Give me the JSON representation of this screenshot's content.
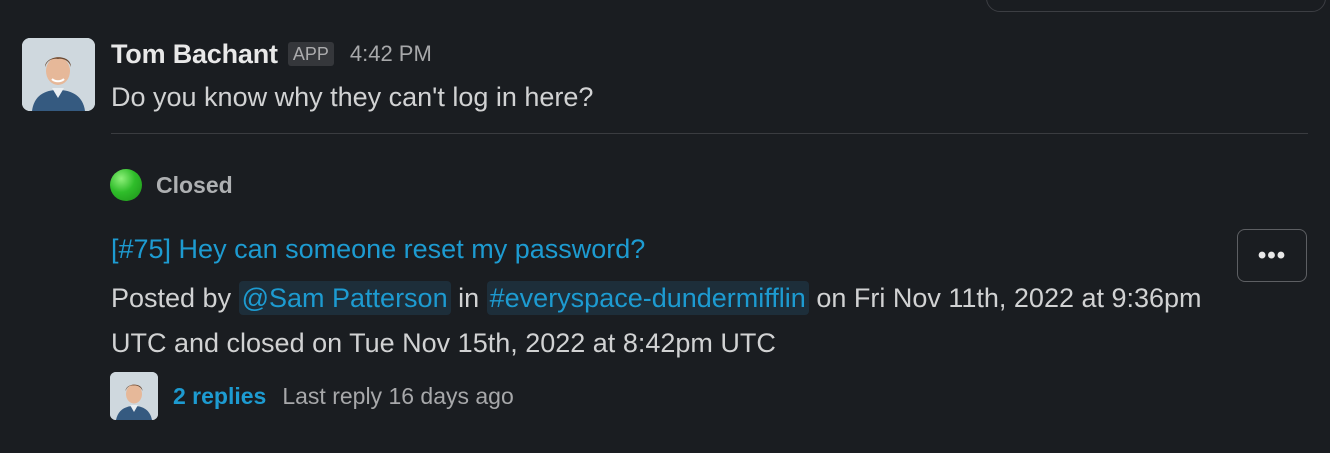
{
  "message": {
    "sender": "Tom Bachant",
    "badge": "APP",
    "time": "4:42 PM",
    "text": "Do you know why they can't log in here?"
  },
  "ticket": {
    "status": "Closed",
    "status_color": "#2fbd2a",
    "link_text": "[#75] Hey can someone reset my password?",
    "posted_prefix": "Posted by",
    "mention": "@Sam Patterson",
    "in_word": "in",
    "channel": "#everyspace-dundermifflin",
    "posted_suffix": "on Fri Nov 11th, 2022 at 9:36pm UTC and closed on Tue Nov 15th, 2022 at 8:42pm UTC",
    "more_label": "•••"
  },
  "thread": {
    "replies": "2 replies",
    "last_reply": "Last reply 16 days ago"
  },
  "colors": {
    "background": "#1a1d21",
    "link": "#1d9bd1"
  }
}
